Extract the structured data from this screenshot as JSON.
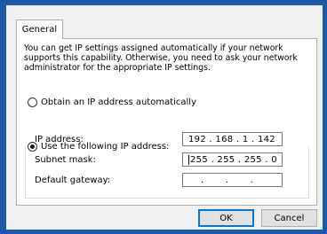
{
  "tab": {
    "label": "General"
  },
  "description": "You can get IP settings assigned automatically if your network supports this capability. Otherwise, you need to ask your network administrator for the appropriate IP settings.",
  "options": {
    "auto_label": "Obtain an IP address automatically",
    "manual_label": "Use the following IP address:",
    "selected": "manual"
  },
  "fields": {
    "ip_label": "IP address:",
    "ip_value": "192 . 168 .  1  . 142",
    "mask_label": "Subnet mask:",
    "mask_value": "255 . 255 . 255 .  0",
    "gateway_label": "Default gateway:",
    "gateway_value": "    .       .       ."
  },
  "buttons": {
    "ok": "OK",
    "cancel": "Cancel"
  }
}
